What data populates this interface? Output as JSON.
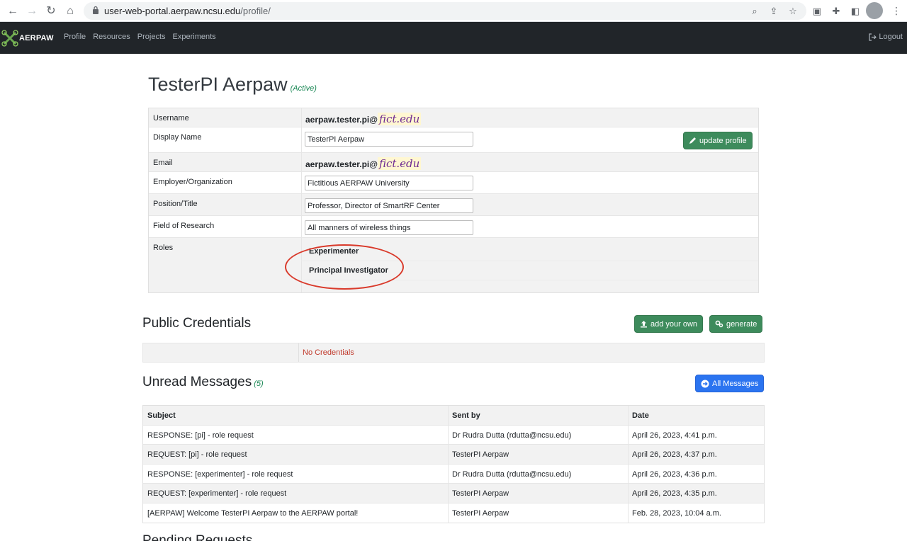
{
  "browser": {
    "url_host": "user-web-portal.aerpaw.ncsu.edu",
    "url_path": "/profile/"
  },
  "navbar": {
    "brand": "AERPAW",
    "links": [
      "Profile",
      "Resources",
      "Projects",
      "Experiments"
    ],
    "logout": "Logout"
  },
  "profile": {
    "name": "TesterPI Aerpaw",
    "status": "(Active)",
    "fields": {
      "username_label": "Username",
      "username_prefix": "aerpaw.tester.pi@",
      "username_domain": "fict.edu",
      "display_name_label": "Display Name",
      "display_name_value": "TesterPI Aerpaw",
      "email_label": "Email",
      "email_prefix": "aerpaw.tester.pi@",
      "email_domain": "fict.edu",
      "employer_label": "Employer/Organization",
      "employer_value": "Fictitious AERPAW University",
      "position_label": "Position/Title",
      "position_value": "Professor, Director of SmartRF Center",
      "field_label": "Field of Research",
      "field_value": "All manners of wireless things",
      "roles_label": "Roles",
      "roles": [
        "Experimenter",
        "Principal Investigator"
      ]
    },
    "update_button": "update profile"
  },
  "credentials": {
    "title": "Public Credentials",
    "add_button": "add your own",
    "generate_button": "generate",
    "empty": "No Credentials"
  },
  "messages": {
    "title": "Unread Messages",
    "count": "(5)",
    "all_button": "All Messages",
    "headers": [
      "Subject",
      "Sent by",
      "Date"
    ],
    "rows": [
      [
        "RESPONSE: [pi] - role request",
        "Dr Rudra Dutta (rdutta@ncsu.edu)",
        "April 26, 2023, 4:41 p.m."
      ],
      [
        "REQUEST: [pi] - role request",
        "TesterPI Aerpaw",
        "April 26, 2023, 4:37 p.m."
      ],
      [
        "RESPONSE: [experimenter] - role request",
        "Dr Rudra Dutta (rdutta@ncsu.edu)",
        "April 26, 2023, 4:36 p.m."
      ],
      [
        "REQUEST: [experimenter] - role request",
        "TesterPI Aerpaw",
        "April 26, 2023, 4:35 p.m."
      ],
      [
        "[AERPAW] Welcome TesterPI Aerpaw to the AERPAW portal!",
        "TesterPI Aerpaw",
        "Feb. 28, 2023, 10:04 a.m."
      ]
    ]
  },
  "pending": {
    "title": "Pending Requests"
  },
  "colors": {
    "navbar": "#212529",
    "success": "#198754",
    "button_green": "#3d8b5c",
    "button_blue": "#2b74f0",
    "annotation_red": "#d93a2b"
  }
}
